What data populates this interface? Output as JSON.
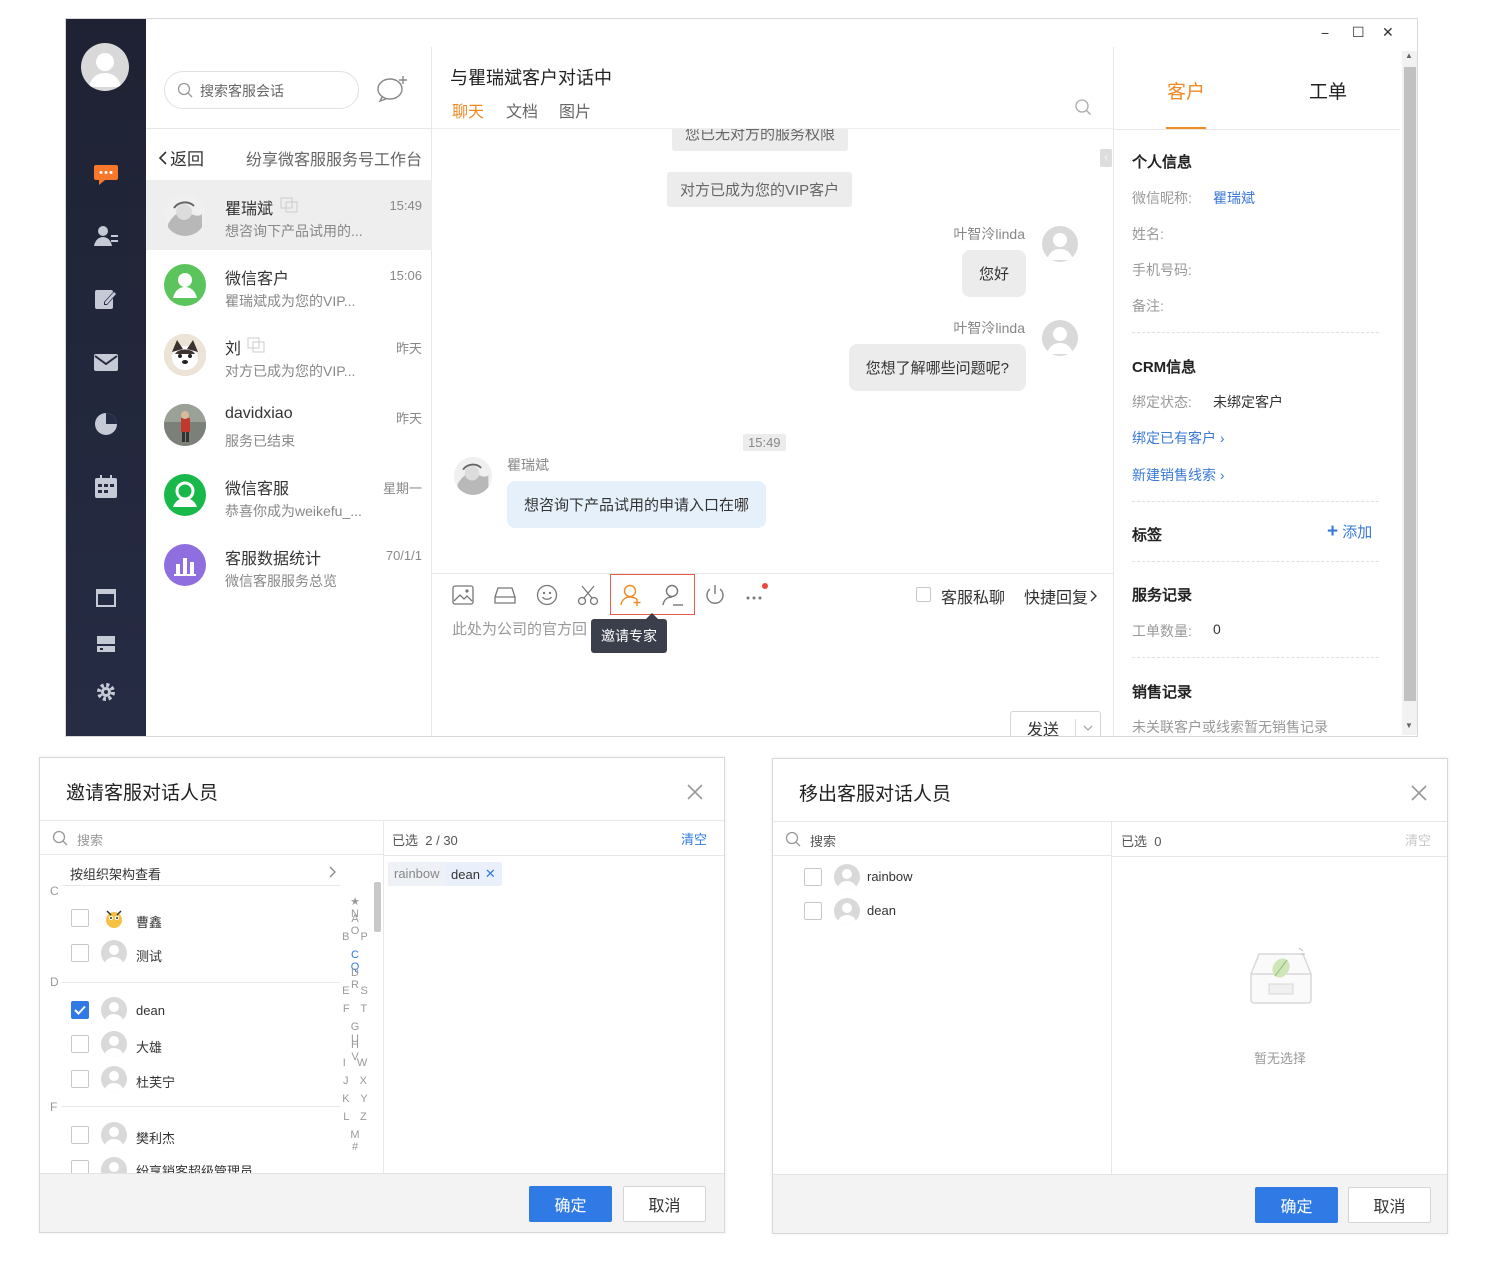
{
  "window": {
    "minimize": "−",
    "maximize": "☐",
    "close": "✕"
  },
  "sidebar": {
    "icons": [
      "chat-icon",
      "contacts-icon",
      "edit-icon",
      "mail-icon",
      "pie-chart-icon",
      "calendar-icon",
      "window-icon",
      "drive-icon",
      "settings-icon"
    ]
  },
  "conversations": {
    "search_placeholder": "搜索客服会话",
    "back_label": "返回",
    "workspace_title": "纷享微客服服务号工作台",
    "items": [
      {
        "name": "瞿瑞斌",
        "preview": "想咨询下产品试用的...",
        "time": "15:49"
      },
      {
        "name": "微信客户",
        "preview": "瞿瑞斌成为您的VIP...",
        "time": "15:06"
      },
      {
        "name": "刘",
        "preview": "对方已成为您的VIP...",
        "time": "昨天"
      },
      {
        "name": "davidxiao",
        "preview": "服务已结束",
        "time": "昨天"
      },
      {
        "name": "微信客服",
        "preview": "恭喜你成为weikefu_...",
        "time": "星期一"
      },
      {
        "name": "客服数据统计",
        "preview": "微信客服服务总览",
        "time": "70/1/1"
      }
    ]
  },
  "chat": {
    "title": "与瞿瑞斌客户对话中",
    "tabs": [
      "聊天",
      "文档",
      "图片"
    ],
    "sys_top": "您已无对方的服务权限",
    "sys_vip": "对方已成为您的VIP客户",
    "msgs": [
      {
        "sender": "叶智泠linda",
        "text": "您好"
      },
      {
        "sender": "叶智泠linda",
        "text": "您想了解哪些问题呢?"
      }
    ],
    "time_divider": "15:49",
    "customer": {
      "sender": "瞿瑞斌",
      "text": "想咨询下产品试用的申请入口在哪"
    },
    "private_chat": "客服私聊",
    "quick_reply": "快捷回复",
    "input_placeholder": "此处为公司的官方回",
    "tooltip": "邀请专家",
    "send": "发送"
  },
  "right": {
    "tabs": [
      "客户",
      "工单"
    ],
    "personal": {
      "title": "个人信息",
      "wx_label": "微信昵称:",
      "wx_value": "瞿瑞斌",
      "name_label": "姓名:",
      "phone_label": "手机号码:",
      "note_label": "备注:"
    },
    "crm": {
      "title": "CRM信息",
      "bind_label": "绑定状态:",
      "bind_value": "未绑定客户",
      "link_bind": "绑定已有客户",
      "link_new": "新建销售线索"
    },
    "tags": {
      "title": "标签",
      "add": "添加"
    },
    "service": {
      "title": "服务记录",
      "count_label": "工单数量:",
      "count_value": "0"
    },
    "sales": {
      "title": "销售记录",
      "empty": "未关联客户或线索暂无销售记录"
    }
  },
  "invite_dialog": {
    "title": "邀请客服对话人员",
    "search": "搜索",
    "selected_label": "已选",
    "selected_count": "2 / 30",
    "clear": "清空",
    "org_view": "按组织架构查看",
    "groups": [
      {
        "letter": "C",
        "people": [
          {
            "name": "曹鑫",
            "checked": false
          },
          {
            "name": "测试",
            "checked": false
          }
        ]
      },
      {
        "letter": "D",
        "people": [
          {
            "name": "dean",
            "checked": true
          },
          {
            "name": "大雄",
            "checked": false
          },
          {
            "name": "杜芙宁",
            "checked": false
          }
        ]
      },
      {
        "letter": "F",
        "people": [
          {
            "name": "樊利杰",
            "checked": false
          },
          {
            "name": "纷享销客超级管理员",
            "checked": false
          }
        ]
      }
    ],
    "index_letters": [
      "★ N",
      "A O",
      "B P",
      "C Q",
      "D R",
      "E S",
      "F T",
      "G U",
      "H V",
      "I W",
      "J X",
      "K Y",
      "L Z",
      "M #"
    ],
    "selected": [
      "rainbow",
      "dean"
    ],
    "confirm": "确定",
    "cancel": "取消"
  },
  "remove_dialog": {
    "title": "移出客服对话人员",
    "search": "搜索",
    "selected_label": "已选",
    "selected_count": "0",
    "clear": "清空",
    "people": [
      "rainbow",
      "dean"
    ],
    "empty": "暂无选择",
    "confirm": "确定",
    "cancel": "取消"
  },
  "colors": {
    "accent": "#f08a24",
    "link": "#3a79d6",
    "primary": "#2f7ae5",
    "nav": "#1e2233"
  }
}
